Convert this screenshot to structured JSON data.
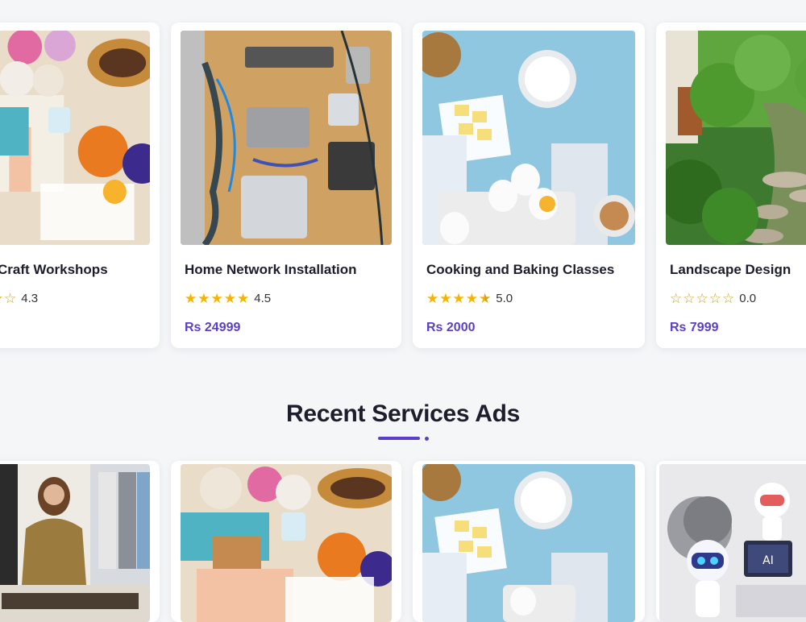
{
  "featured": [
    {
      "title": "Craft Workshops",
      "rating": "4.3",
      "stars": [
        "full",
        "full",
        "full",
        "full",
        "empty"
      ],
      "price": "",
      "image": "craft-workshop-photo"
    },
    {
      "title": "Home Network Installation",
      "rating": "4.5",
      "stars": [
        "full",
        "full",
        "full",
        "full",
        "full"
      ],
      "price": "Rs 24999",
      "image": "network-rack-photo"
    },
    {
      "title": "Cooking and Baking Classes",
      "rating": "5.0",
      "stars": [
        "full",
        "full",
        "full",
        "full",
        "half"
      ],
      "price": "Rs 2000",
      "image": "baking-ingredients-photo"
    },
    {
      "title": "Landscape Design",
      "rating": "0.0",
      "stars": [
        "empty",
        "empty",
        "empty",
        "empty",
        "empty"
      ],
      "price": "Rs 7999",
      "image": "garden-path-photo"
    }
  ],
  "recent": {
    "title": "Recent Services Ads",
    "cards": [
      {
        "image": "fashion-stylist-photo"
      },
      {
        "image": "craft-workshop-photo"
      },
      {
        "image": "baking-ingredients-photo"
      },
      {
        "image": "ai-robots-illustration",
        "badge": "AI"
      }
    ]
  },
  "colors": {
    "accent": "#5b3fc8",
    "star": "#f4b400",
    "background": "#f5f6f8"
  }
}
